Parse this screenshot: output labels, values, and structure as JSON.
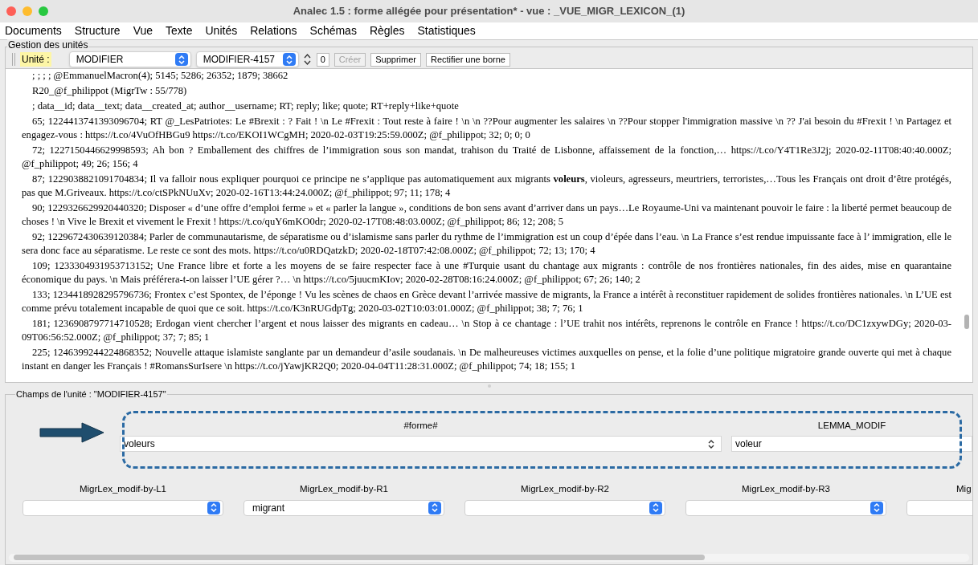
{
  "window": {
    "title": "Analec 1.5 : forme allégée pour présentation* - vue : _VUE_MIGR_LEXICON_(1)"
  },
  "menu": [
    "Documents",
    "Structure",
    "Vue",
    "Texte",
    "Unités",
    "Relations",
    "Schémas",
    "Règles",
    "Statistiques"
  ],
  "units_panel": {
    "title": "Gestion des unités",
    "unit_label": "Unité :",
    "type_select": "MODIFIER",
    "unit_select": "MODIFIER-4157",
    "count": "0",
    "buttons": [
      {
        "label": "Créer",
        "disabled": true
      },
      {
        "label": "Supprimer",
        "disabled": false
      },
      {
        "label": "Rectifier une borne",
        "disabled": false
      }
    ]
  },
  "text_lines": [
    "; ; ; ; @EmmanuelMacron(4); 5145; 5286; 26352; 1879; 38662",
    "R20_@f_philippot (MigrTw : 55/778)",
    "; data__id; data__text; data__created_at; author__username; RT; reply; like; quote; RT+reply+like+quote",
    "65; 1224413741393096704; RT @_LesPatriotes: Le #Brexit : ? Fait ! \\n Le #Frexit : Tout reste à faire ! \\n  \\n ??Pour augmenter les salaires \\n ??Pour stopper l'immigration massive \\n ?? J'ai besoin du #Frexit !  \\n Partagez et engagez-vous : https://t.co/4VuOfHBGu9 https://t.co/EKOI1WCgMH; 2020-02-03T19:25:59.000Z; @f_philippot; 32; 0; 0; 0",
    "72; 1227150446629998593; Ah bon ? Emballement des chiffres de l’immigration sous son mandat, trahison du Traité de Lisbonne, affaissement de la fonction,… https://t.co/Y4T1Re3J2j; 2020-02-11T08:40:40.000Z; @f_philippot; 49; 26; 156; 4",
    "87; 1229038821091704834; Il va falloir nous expliquer pourquoi ce principe ne s’applique pas automatiquement aux migrants **voleurs**, violeurs, agresseurs, meurtriers, terroristes,…Tous les Français ont droit d’être protégés, pas que M.Griveaux. https://t.co/ctSPkNUuXv; 2020-02-16T13:44:24.000Z; @f_philippot; 97; 11; 178; 4",
    "90; 1229326629920440320; Disposer « d’une offre d’emploi ferme » et « parler la langue », conditions de bon sens avant d’arriver dans un pays…Le Royaume-Uni va maintenant pouvoir le faire : la liberté permet beaucoup de choses !  \\n Vive le Brexit et vivement le Frexit ! https://t.co/quY6mKO0dr; 2020-02-17T08:48:03.000Z; @f_philippot; 86; 12; 208; 5",
    "92; 1229672430639120384; Parler de communautarisme, de séparatisme ou d’islamisme sans parler du rythme de l’immigration est un coup d’épée dans l’eau.  \\n La France s’est rendue impuissante face à l’ immigration, elle le sera donc face au séparatisme. Le reste ce sont des mots. https://t.co/u0RDQatzkD; 2020-02-18T07:42:08.000Z; @f_philippot; 72; 13; 170; 4",
    "109; 1233304931953713152; Une France libre et forte a les moyens de se faire respecter face à une #Turquie usant du chantage aux migrants : contrôle de nos frontières nationales, fin des aides, mise en quarantaine économique du pays.  \\n Mais préférera-t-on laisser l’UE gérer ?… \\n  https://t.co/5juucmKIov; 2020-02-28T08:16:24.000Z; @f_philippot; 67; 26; 140; 2",
    "133; 1234418928295796736; Frontex c’est Spontex, de l’éponge ! Vu les scènes de chaos en Grèce devant l’arrivée massive de migrants, la France a intérêt à reconstituer rapidement de solides frontières nationales. \\n L’UE est comme prévu totalement incapable de quoi que ce soit. https://t.co/K3nRUGdpTg; 2020-03-02T10:03:01.000Z; @f_philippot; 38; 7; 76; 1",
    "181; 1236908797714710528; Erdogan vient chercher l’argent et nous laisser des migrants en cadeau… \\n Stop à ce chantage : l’UE trahit nos intérêts, reprenons le contrôle en France ! https://t.co/DC1zxywDGy; 2020-03-09T06:56:52.000Z; @f_philippot; 37; 7; 85; 1",
    "225; 1246399244224868352; Nouvelle attaque islamiste sanglante par un demandeur d’asile soudanais. \\n De malheureuses victimes auxquelles on pense, et la folie d’une politique migratoire grande ouverte qui met à chaque instant en danger les Français ! #RomansSurIsere  \\n  https://t.co/jYawjKR2Q0; 2020-04-04T11:28:31.000Z; @f_philippot; 74; 18; 155; 1"
  ],
  "fields_panel": {
    "title": "Champs de l'unité :  \"MODIFIER-4157\"",
    "main_fields": [
      {
        "label": "#forme#",
        "value": "voleurs",
        "kind": "select"
      },
      {
        "label": "LEMMA_MODIF",
        "value": "voleur",
        "kind": "text"
      }
    ],
    "fields": [
      {
        "label": "MigrLex_modif-by-L1"
      },
      {
        "label": "MigrLex_modif-by-R1",
        "value": "migrant"
      },
      {
        "label": "MigrLex_modif-by-R2"
      },
      {
        "label": "MigrLex_modif-by-R3"
      },
      {
        "label": "Mig"
      }
    ]
  }
}
